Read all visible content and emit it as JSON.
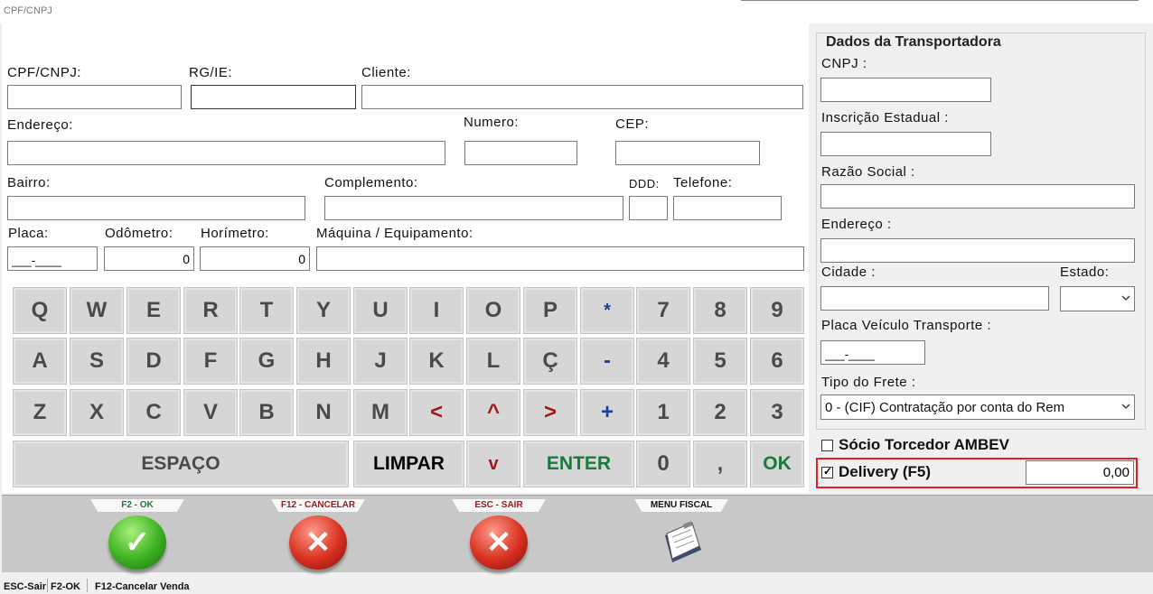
{
  "window": {
    "title": "CPF/CNPJ"
  },
  "cliente": {
    "cpf_label": "CPF/CNPJ:",
    "cpf_value": "",
    "rg_label": "RG/IE:",
    "rg_value": "",
    "cliente_label": "Cliente:",
    "cliente_value": "",
    "endereco_label": "Endereço:",
    "endereco_value": "",
    "numero_label": "Numero:",
    "numero_value": "",
    "cep_label": "CEP:",
    "cep_value": "",
    "bairro_label": "Bairro:",
    "bairro_value": "",
    "complemento_label": "Complemento:",
    "complemento_value": "",
    "ddd_label": "DDD:",
    "ddd_value": "",
    "telefone_label": "Telefone:",
    "telefone_value": "",
    "placa_label": "Placa:",
    "placa_value": "___-____",
    "odometro_label": "Odômetro:",
    "odometro_value": "0",
    "horimetro_label": "Horímetro:",
    "horimetro_value": "0",
    "maquina_label": "Máquina / Equipamento:",
    "maquina_value": ""
  },
  "keyboard": {
    "row1": [
      "Q",
      "W",
      "E",
      "R",
      "T",
      "Y",
      "U",
      "I",
      "O",
      "P",
      "*",
      "7",
      "8",
      "9"
    ],
    "row2": [
      "A",
      "S",
      "D",
      "F",
      "G",
      "H",
      "J",
      "K",
      "L",
      "Ç",
      "-",
      "4",
      "5",
      "6"
    ],
    "row3": [
      "Z",
      "X",
      "C",
      "V",
      "B",
      "N",
      "M",
      "<",
      "^",
      ">",
      "+",
      "1",
      "2",
      "3"
    ],
    "space": "ESPAÇO",
    "clear": "LIMPAR",
    "down": "v",
    "enter": "ENTER",
    "zero": "0",
    "comma": ",",
    "ok": "OK"
  },
  "transportadora": {
    "title": "Dados da Transportadora",
    "cnpj_label": "CNPJ :",
    "cnpj_value": "",
    "ie_label": "Inscrição Estadual :",
    "ie_value": "",
    "razao_label": "Razão Social :",
    "razao_value": "",
    "endereco_label": "Endereço :",
    "endereco_value": "",
    "cidade_label": "Cidade :",
    "cidade_value": "",
    "estado_label": "Estado:",
    "estado_value": "",
    "placa_label": "Placa Veículo Transporte :",
    "placa_value": "___-____",
    "frete_label": "Tipo do Frete :",
    "frete_value": "0 -  (CIF) Contratação por conta do Rem"
  },
  "options": {
    "socio_label": "Sócio Torcedor AMBEV",
    "socio_checked": false,
    "delivery_label": "Delivery (F5)",
    "delivery_checked": true,
    "delivery_value": "0,00"
  },
  "toolbar": {
    "ok_label": "F2 - OK",
    "cancel_label": "F12 - CANCELAR",
    "exit_label": "ESC - SAIR",
    "fiscal_label": "MENU FISCAL"
  },
  "statusbar": {
    "esc": "ESC-Sair",
    "f2": "F2-OK",
    "f12": "F12-Cancelar Venda"
  },
  "colors": {
    "delivery_border": "#e02020",
    "ok_green": "#1a7a3a",
    "cancel_red": "#a01818",
    "key_blue": "#2040a0"
  }
}
